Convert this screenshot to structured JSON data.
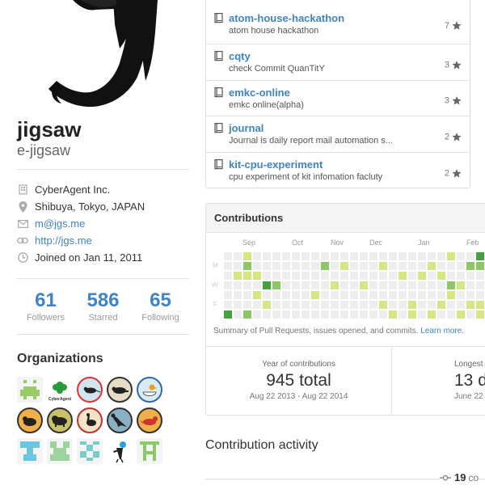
{
  "profile": {
    "fullname": "jigsaw",
    "username": "e-jigsaw",
    "details": [
      {
        "icon": "organization-icon",
        "text": "CyberAgent Inc.",
        "link": false
      },
      {
        "icon": "location-icon",
        "text": "Shibuya, Tokyo, JAPAN",
        "link": false
      },
      {
        "icon": "mail-icon",
        "text": "m@jgs.me",
        "link": true
      },
      {
        "icon": "link-icon",
        "text": "http://jgs.me",
        "link": true
      },
      {
        "icon": "clock-icon",
        "text": "Joined on Jan 11, 2011",
        "link": false
      }
    ],
    "stats": [
      {
        "num": "61",
        "label": "Followers"
      },
      {
        "num": "586",
        "label": "Starred"
      },
      {
        "num": "65",
        "label": "Following"
      }
    ]
  },
  "organizations": {
    "title": "Organizations",
    "items": [
      {
        "name": "org-pixel-green"
      },
      {
        "name": "org-cyberagent",
        "label": "CyberAgent"
      },
      {
        "name": "org-round-rat"
      },
      {
        "name": "org-round-beaver"
      },
      {
        "name": "org-round-duck"
      },
      {
        "name": "org-round-capybara"
      },
      {
        "name": "org-round-bison"
      },
      {
        "name": "org-round-meerkat"
      },
      {
        "name": "org-round-dinosaur"
      },
      {
        "name": "org-round-fox"
      },
      {
        "name": "org-pixel-cyan"
      },
      {
        "name": "org-pixel-mint"
      },
      {
        "name": "org-pixel-teal"
      },
      {
        "name": "org-figure"
      },
      {
        "name": "org-pixel-lime"
      }
    ]
  },
  "repos": [
    {
      "name": "atom-house-hackathon",
      "desc": "atom house hackathon",
      "stars": "7"
    },
    {
      "name": "cqty",
      "desc": "check Commit QuanTitY",
      "stars": "3"
    },
    {
      "name": "emkc-online",
      "desc": "emkc online(alpha)",
      "stars": "3"
    },
    {
      "name": "journal",
      "desc": "Journal is daily report mail automation s...",
      "stars": "2"
    },
    {
      "name": "kit-cpu-experiment",
      "desc": "cpu experiment of kit infomation facluty",
      "stars": "2"
    }
  ],
  "contributions": {
    "title": "Contributions",
    "months": [
      "Sep",
      "Oct",
      "Nov",
      "Dec",
      "Jan",
      "Feb"
    ],
    "days": [
      "M",
      "W",
      "F"
    ],
    "note": "Summary of Pull Requests, issues opened, and commits.",
    "note_link": "Learn more.",
    "year_label": "Year of contributions",
    "year_total": "945 total",
    "year_range": "Aug 22 2013 - Aug 22 2014",
    "longest_label": "Longest",
    "longest_value": "13 d",
    "longest_range": "June 22 -",
    "colors": {
      "empty": "#eeeeee",
      "l1": "#d6e685",
      "l2": "#8cc665",
      "l3": "#44a340",
      "l4": "#1e6823"
    }
  },
  "activity": {
    "title": "Contribution activity",
    "commits_count": "19",
    "commits_text": "co"
  }
}
